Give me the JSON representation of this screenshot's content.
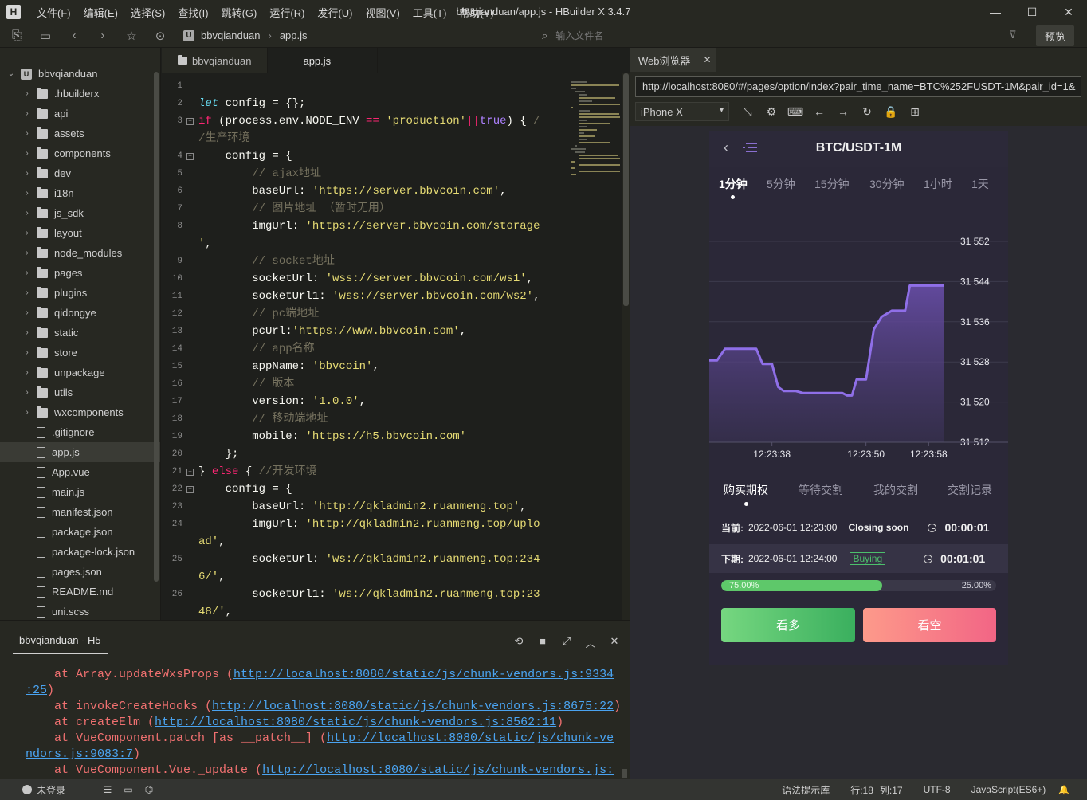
{
  "app": {
    "window_title": "bbvqianduan/app.js - HBuilder X 3.4.7",
    "logo_letter": "H",
    "menu": [
      "文件(F)",
      "编辑(E)",
      "选择(S)",
      "查找(I)",
      "跳转(G)",
      "运行(R)",
      "发行(U)",
      "视图(V)",
      "工具(T)",
      "帮助(Y)"
    ],
    "controls": {
      "minimize": "—",
      "maximize": "☐",
      "close": "✕"
    }
  },
  "toolbar": {
    "breadcrumb_root_badge": "U",
    "breadcrumb": [
      "bbvqianduan",
      "app.js"
    ],
    "breadcrumb_sep": "›",
    "file_search_placeholder": "输入文件名",
    "preview_label": "预览"
  },
  "sidebar": {
    "root": "bbvqianduan",
    "root_badge": "U",
    "items": [
      {
        "name": ".hbuilderx",
        "type": "folder"
      },
      {
        "name": "api",
        "type": "folder"
      },
      {
        "name": "assets",
        "type": "folder"
      },
      {
        "name": "components",
        "type": "folder"
      },
      {
        "name": "dev",
        "type": "folder"
      },
      {
        "name": "i18n",
        "type": "folder"
      },
      {
        "name": "js_sdk",
        "type": "folder"
      },
      {
        "name": "layout",
        "type": "folder"
      },
      {
        "name": "node_modules",
        "type": "folder"
      },
      {
        "name": "pages",
        "type": "folder"
      },
      {
        "name": "plugins",
        "type": "folder"
      },
      {
        "name": "qidongye",
        "type": "folder"
      },
      {
        "name": "static",
        "type": "folder"
      },
      {
        "name": "store",
        "type": "folder"
      },
      {
        "name": "unpackage",
        "type": "folder"
      },
      {
        "name": "utils",
        "type": "folder"
      },
      {
        "name": "wxcomponents",
        "type": "folder"
      },
      {
        "name": ".gitignore",
        "type": "file"
      },
      {
        "name": "app.js",
        "type": "file",
        "active": true
      },
      {
        "name": "App.vue",
        "type": "file"
      },
      {
        "name": "main.js",
        "type": "file"
      },
      {
        "name": "manifest.json",
        "type": "file"
      },
      {
        "name": "package.json",
        "type": "file"
      },
      {
        "name": "package-lock.json",
        "type": "file"
      },
      {
        "name": "pages.json",
        "type": "file"
      },
      {
        "name": "README.md",
        "type": "file"
      },
      {
        "name": "uni.scss",
        "type": "file"
      }
    ]
  },
  "editor": {
    "tabs": [
      "bbvqianduan",
      "app.js"
    ],
    "active_tab": "app.js",
    "lines": [
      {
        "n": "1",
        "html": ""
      },
      {
        "n": "2",
        "html": "<span class='kw'>let</span> config = {};"
      },
      {
        "n": "3",
        "fold": true,
        "html": "<span class='kw2'>if</span> (process.env.NODE_ENV <span class='kw2'>==</span> <span class='str'>'production'</span><span class='kw2'>||</span><span class='bool'>true</span>) { <span class='cm'>/</span>"
      },
      {
        "n": "",
        "html": "<span class='cm'>/生产环境</span>"
      },
      {
        "n": "4",
        "fold": true,
        "html": "    config = {"
      },
      {
        "n": "5",
        "html": "        <span class='cm'>// ajax地址</span>"
      },
      {
        "n": "6",
        "html": "        baseUrl: <span class='str'>'https://server.bbvcoin.com'</span>,"
      },
      {
        "n": "7",
        "html": "        <span class='cm'>// 图片地址 （暂时无用）</span>"
      },
      {
        "n": "8",
        "html": "        imgUrl: <span class='str'>'https://server.bbvcoin.com/storage</span>"
      },
      {
        "n": "",
        "html": "<span class='str'>'</span>,"
      },
      {
        "n": "9",
        "html": "        <span class='cm'>// socket地址</span>"
      },
      {
        "n": "10",
        "html": "        socketUrl: <span class='str'>'wss://server.bbvcoin.com/ws1'</span>,"
      },
      {
        "n": "11",
        "html": "        socketUrl1: <span class='str'>'wss://server.bbvcoin.com/ws2'</span>,"
      },
      {
        "n": "12",
        "html": "        <span class='cm'>// pc端地址</span>"
      },
      {
        "n": "13",
        "html": "        pcUrl:<span class='str'>'https://www.bbvcoin.com'</span>,"
      },
      {
        "n": "14",
        "html": "        <span class='cm'>// app名称</span>"
      },
      {
        "n": "15",
        "html": "        appName: <span class='str'>'bbvcoin'</span>,"
      },
      {
        "n": "16",
        "html": "        <span class='cm'>// 版本</span>"
      },
      {
        "n": "17",
        "html": "        version: <span class='str'>'1.0.0'</span>,"
      },
      {
        "n": "18",
        "html": "        <span class='cm'>// 移动端地址</span>"
      },
      {
        "n": "19",
        "html": "        mobile: <span class='str'>'https://h5.bbvcoin.com'</span>"
      },
      {
        "n": "20",
        "html": "    };"
      },
      {
        "n": "21",
        "fold": true,
        "html": "} <span class='kw2'>else</span> { <span class='cm'>//开发环境</span>"
      },
      {
        "n": "22",
        "fold": true,
        "html": "    config = {"
      },
      {
        "n": "23",
        "html": "        baseUrl: <span class='str'>'http://qkladmin2.ruanmeng.top'</span>,"
      },
      {
        "n": "24",
        "html": "        imgUrl: <span class='str'>'http://qkladmin2.ruanmeng.top/uplo</span>"
      },
      {
        "n": "",
        "html": "<span class='str'>ad'</span>,"
      },
      {
        "n": "25",
        "html": "        socketUrl: <span class='str'>'ws://qkladmin2.ruanmeng.top:234</span>"
      },
      {
        "n": "",
        "html": "<span class='str'>6/'</span>,"
      },
      {
        "n": "26",
        "html": "        socketUrl1: <span class='str'>'ws://qkladmin2.ruanmeng.top:23</span>"
      },
      {
        "n": "",
        "html": "<span class='str'>48/'</span>,"
      }
    ]
  },
  "console": {
    "tab": "bbvqianduan - H5",
    "icons": [
      "⟲",
      "■",
      "⤢",
      "︿",
      "✕"
    ],
    "lines": [
      {
        "pre": "    at Array.updateWxsProps (",
        "link": "http://localhost:8080/static/js/chunk-vendors.js:9334",
        "post": ""
      },
      {
        "pre": "",
        "link": ":25",
        "post": ")"
      },
      {
        "pre": "    at invokeCreateHooks (",
        "link": "http://localhost:8080/static/js/chunk-vendors.js:8675:22",
        "post": ")"
      },
      {
        "pre": "    at createElm (",
        "link": "http://localhost:8080/static/js/chunk-vendors.js:8562:11",
        "post": ")"
      },
      {
        "pre": "    at VueComponent.patch [as __patch__] (",
        "link": "http://localhost:8080/static/js/chunk-ve",
        "post": ""
      },
      {
        "pre": "",
        "link": "ndors.js:9083:7",
        "post": ")"
      },
      {
        "pre": "    at VueComponent.Vue._update (",
        "link": "http://localhost:8080/static/js/chunk-vendors.js:",
        "post": ""
      }
    ]
  },
  "browser": {
    "tab": "Web浏览器",
    "tab_close": "✕",
    "url": "http://localhost:8080/#/pages/option/index?pair_time_name=BTC%252FUSDT-1M&pair_id=1&",
    "device": "iPhone X",
    "device_icons": [
      "⤡",
      "⚙",
      "⌨",
      "←",
      "→",
      "↻",
      "🔒",
      "⊞"
    ]
  },
  "phone": {
    "back": "‹",
    "title": "BTC/USDT-1M",
    "periods": [
      "1分钟",
      "5分钟",
      "15分钟",
      "30分钟",
      "1小时",
      "1天"
    ],
    "active_period": 0,
    "option_tabs": [
      "购买期权",
      "等待交割",
      "我的交割",
      "交割记录"
    ],
    "active_option_tab": 0,
    "current": {
      "label": "当前:",
      "time": "2022-06-01 12:23:00",
      "status": "Closing soon",
      "countdown": "00:00:01"
    },
    "next": {
      "label": "下期:",
      "time": "2022-06-01 12:24:00",
      "status": "Buying",
      "countdown": "00:01:01"
    },
    "progress": {
      "up": 0.75,
      "up_label": "75.00%",
      "down_label": "25.00%"
    },
    "buttons": {
      "up": "看多",
      "down": "看空"
    },
    "colors": {
      "line": "#8f6fe8",
      "up": "#5ec86a",
      "down": "#f26585"
    }
  },
  "chart_data": {
    "type": "area",
    "title": "BTC/USDT-1M",
    "x_ticks": [
      "12:23:38",
      "12:23:50",
      "12:23:58"
    ],
    "y_ticks": [
      31512,
      31520,
      31528,
      31536,
      31544,
      31552
    ],
    "y_tick_labels": [
      "31 512",
      "31 520",
      "31 528",
      "31 536",
      "31 544",
      "31 552"
    ],
    "ylim": [
      31512,
      31552
    ],
    "x_seconds": [
      30,
      31,
      32,
      34,
      36,
      36.8,
      38,
      38.8,
      39.5,
      41,
      42,
      42.6,
      45,
      47,
      47.6,
      48.2,
      48.8,
      50,
      51,
      52,
      53.3,
      54,
      55,
      55.6,
      58,
      60
    ],
    "y": [
      31528.3,
      31528.3,
      31530.6,
      31530.6,
      31530.6,
      31527.6,
      31527.6,
      31523.0,
      31522.2,
      31522.2,
      31521.8,
      31521.8,
      31521.8,
      31521.8,
      31521.3,
      31521.3,
      31524.5,
      31524.5,
      31534.5,
      31537.0,
      31538.2,
      31538.2,
      31538.2,
      31543.2,
      31543.2,
      31543.2
    ],
    "grid": true,
    "y_axis_side": "right"
  },
  "statusbar": {
    "user": "未登录",
    "icons": [
      "☰",
      "▭",
      "⌬"
    ],
    "hint": "语法提示库",
    "line": "行:18",
    "col": "列:17",
    "encoding": "UTF-8",
    "language": "JavaScript(ES6+)",
    "bell": "🔔"
  }
}
